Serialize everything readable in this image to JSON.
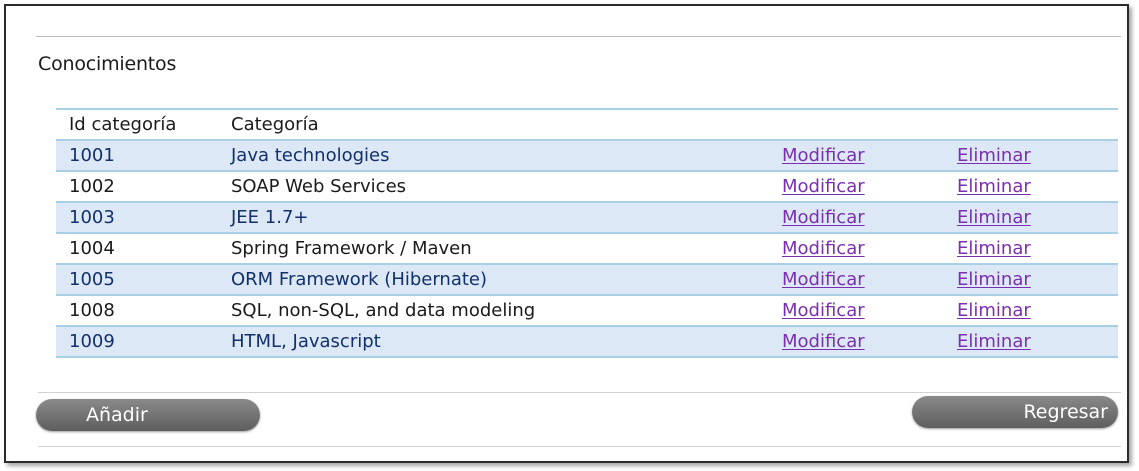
{
  "section": {
    "title": "Conocimientos"
  },
  "table": {
    "headers": {
      "id": "Id categoría",
      "category": "Categoría"
    },
    "rows": [
      {
        "id": "1001",
        "category": "Java technologies",
        "modify": "Modificar",
        "delete": "Eliminar"
      },
      {
        "id": "1002",
        "category": "SOAP Web Services",
        "modify": "Modificar",
        "delete": "Eliminar"
      },
      {
        "id": "1003",
        "category": "JEE 1.7+",
        "modify": "Modificar",
        "delete": "Eliminar"
      },
      {
        "id": "1004",
        "category": "Spring Framework / Maven",
        "modify": "Modificar",
        "delete": "Eliminar"
      },
      {
        "id": "1005",
        "category": "ORM Framework (Hibernate)",
        "modify": "Modificar",
        "delete": "Eliminar"
      },
      {
        "id": "1008",
        "category": "SQL, non-SQL, and data modeling",
        "modify": "Modificar",
        "delete": "Eliminar"
      },
      {
        "id": "1009",
        "category": "HTML, Javascript",
        "modify": "Modificar",
        "delete": "Eliminar"
      }
    ]
  },
  "actions": {
    "add_label": "Añadir",
    "back_label": "Regresar"
  },
  "colors": {
    "row_shade": "#dde8f7",
    "row_rule": "#a9cfe6",
    "link": "#7a2fb0",
    "button": "#6f6f6f"
  }
}
